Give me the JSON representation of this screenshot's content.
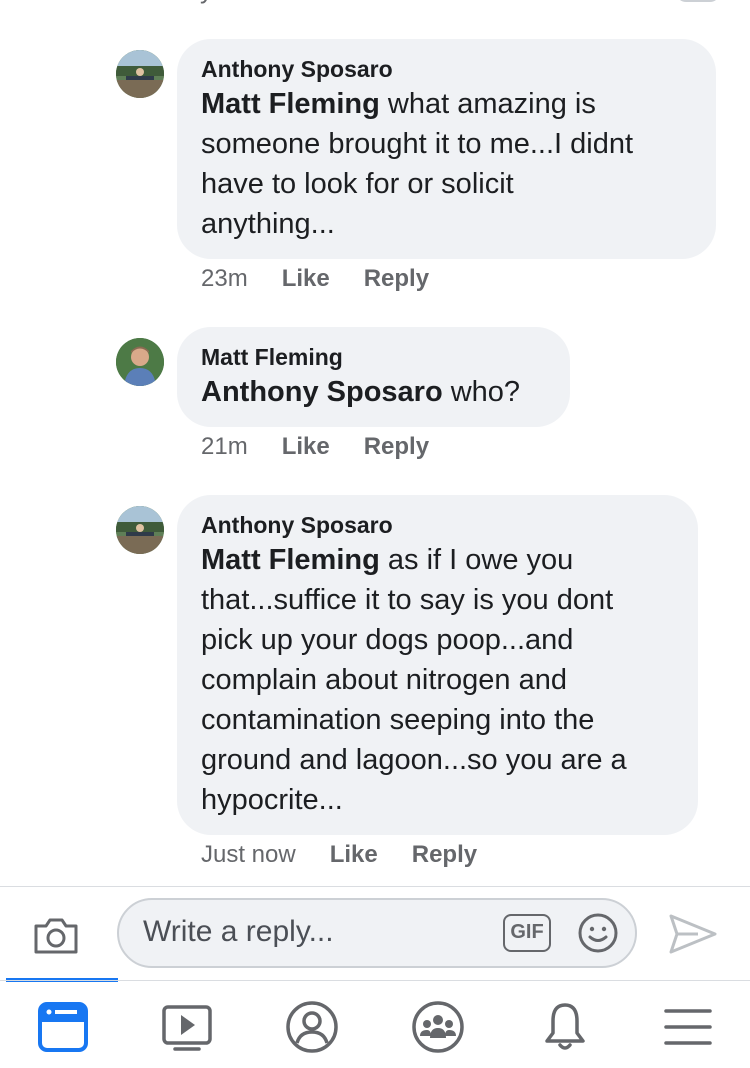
{
  "comments": [
    {
      "author": "Anthony Sposaro",
      "mention": "Matt Fleming",
      "text_lines": [
        " what amazing is",
        "someone brought it to me...I didnt",
        "have to look for or solicit",
        "anything..."
      ],
      "time": "23m",
      "like": "Like",
      "reply": "Reply"
    },
    {
      "author": "Matt Fleming",
      "mention": "Anthony Sposaro",
      "text_lines": [
        " who?"
      ],
      "time": "21m",
      "like": "Like",
      "reply": "Reply"
    },
    {
      "author": "Anthony Sposaro",
      "mention": "Matt Fleming",
      "text_lines": [
        " as if I owe you",
        "that...suffice it to say is you dont",
        "pick up your dogs poop...and",
        "complain about nitrogen and",
        "contamination seeping into the",
        "ground and lagoon...so you are a",
        "hypocrite..."
      ],
      "time": "Just now",
      "like": "Like",
      "reply": "Reply"
    }
  ],
  "reply_bar": {
    "placeholder": "Write a reply...",
    "gif_label": "GIF",
    "camera_icon": "camera-icon",
    "emoji_icon": "smiley-icon",
    "send_icon": "send-icon"
  },
  "tab_bar": {
    "active_color": "#1877f2",
    "tabs": [
      "news-feed-icon",
      "watch-icon",
      "profile-icon",
      "groups-icon",
      "notifications-icon",
      "menu-icon"
    ]
  }
}
